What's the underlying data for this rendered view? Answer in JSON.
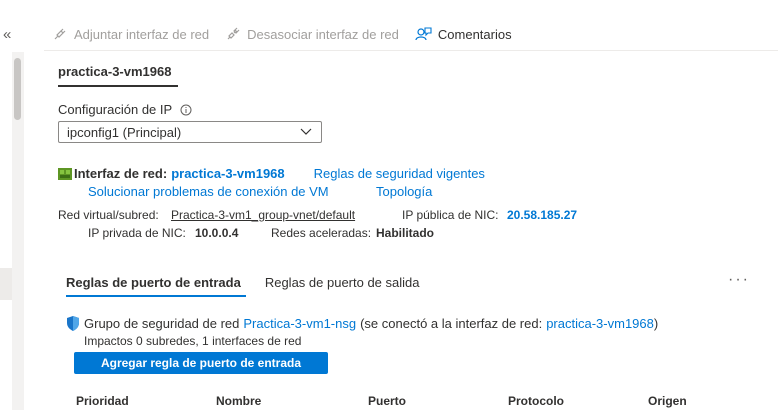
{
  "rail": {
    "collapse_icon": "«"
  },
  "toolbar": {
    "attach_label": "Adjuntar interfaz de red",
    "detach_label": "Desasociar interfaz de red",
    "feedback_label": "Comentarios"
  },
  "vm": {
    "name": "practica-3-vm1968"
  },
  "ip_config": {
    "label": "Configuración de IP",
    "selected": "ipconfig1 (Principal)"
  },
  "nic": {
    "label": "Interfaz de red:",
    "name": "practica-3-vm1968",
    "effective_rules_link": "Reglas de seguridad vigentes",
    "troubleshoot_link": "Solucionar problemas de conexión de VM",
    "topology_link": "Topología",
    "vnet_label": "Red virtual/subred:",
    "vnet_value": "Practica-3-vm1_group-vnet/default",
    "public_ip_label": "IP pública de NIC:",
    "public_ip_value": "20.58.185.27",
    "private_ip_label": "IP privada de NIC:",
    "private_ip_value": "10.0.0.4",
    "accel_label": "Redes aceleradas:",
    "accel_value": "Habilitado"
  },
  "tabs": {
    "inbound": "Reglas de puerto de entrada",
    "outbound": "Reglas de puerto de salida",
    "more": "···"
  },
  "nsg": {
    "prefix": "Grupo de seguridad de red",
    "name": "Practica-3-vm1-nsg",
    "middle": "(se conectó a la interfaz de red:",
    "nic": "practica-3-vm1968",
    "suffix": ")",
    "impact": "Impactos 0 subredes, 1 interfaces de red",
    "add_button": "Agregar regla de puerto de entrada"
  },
  "table": {
    "headers": [
      "Prioridad",
      "Nombre",
      "Puerto",
      "Protocolo",
      "Origen"
    ]
  },
  "colors": {
    "accent": "#0078d4",
    "text": "#323130",
    "disabled": "#a19f9d"
  }
}
